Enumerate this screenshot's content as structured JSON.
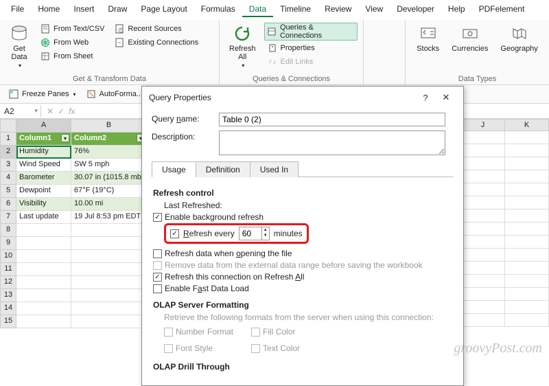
{
  "menu": {
    "items": [
      "File",
      "Home",
      "Insert",
      "Draw",
      "Page Layout",
      "Formulas",
      "Data",
      "Timeline",
      "Review",
      "View",
      "Developer",
      "Help",
      "PDFelement"
    ],
    "active": "Data"
  },
  "ribbon": {
    "get_data": "Get\nData",
    "get_transform_items": [
      "From Text/CSV",
      "Recent Sources",
      "From Web",
      "Existing Connections",
      "From Sheet"
    ],
    "get_transform_label": "Get & Transform Data",
    "refresh_all": "Refresh\nAll",
    "qc_items": [
      "Queries & Connections",
      "Properties",
      "Edit Links"
    ],
    "qc_label": "Queries & Connections",
    "datatypes": [
      "Stocks",
      "Currencies",
      "Geography"
    ],
    "datatypes_label": "Data Types"
  },
  "qat": {
    "freeze": "Freeze Panes",
    "autoformat": "AutoForma..."
  },
  "namebox": "A2",
  "fx": {
    "x": "✕",
    "check": "✓",
    "fx": "fx"
  },
  "grid": {
    "cols": [
      "A",
      "B"
    ],
    "rightcols": [
      "J",
      "K"
    ],
    "header": [
      "Column1",
      "Column2"
    ],
    "rows": [
      {
        "n": 2,
        "a": "Humidity",
        "b": "76%"
      },
      {
        "n": 3,
        "a": "Wind Speed",
        "b": "SW 5 mph"
      },
      {
        "n": 4,
        "a": "Barometer",
        "b": "30.07 in (1015.8 mb)"
      },
      {
        "n": 5,
        "a": "Dewpoint",
        "b": "67°F (19°C)"
      },
      {
        "n": 6,
        "a": "Visibility",
        "b": "10.00 mi"
      },
      {
        "n": 7,
        "a": "Last update",
        "b": "19 Jul 8:53 pm EDT"
      }
    ],
    "empty": [
      8,
      9,
      10,
      11,
      12,
      13,
      14,
      15
    ]
  },
  "dialog": {
    "title": "Query Properties",
    "help": "?",
    "close": "✕",
    "qname_label": "Query name:",
    "qname_value": "Table 0 (2)",
    "desc_label": "Description:",
    "tabs": [
      "Usage",
      "Definition",
      "Used In"
    ],
    "active_tab": "Usage",
    "section_refresh": "Refresh control",
    "last_refreshed": "Last Refreshed:",
    "enable_bg": "Enable background refresh",
    "refresh_every_pre": "Refresh every",
    "refresh_every_val": "60",
    "refresh_every_post": "minutes",
    "refresh_open": "Refresh data when opening the file",
    "remove_data": "Remove data from the external data range before saving the workbook",
    "refresh_all_chk": "Refresh this connection on Refresh All",
    "fast_load": "Enable Fast Data Load",
    "olap_fmt": "OLAP Server Formatting",
    "olap_msg": "Retrieve the following formats from the server when using this connection:",
    "olap_items": [
      "Number Format",
      "Fill Color",
      "Font Style",
      "Text Color"
    ],
    "olap_drill": "OLAP Drill Through"
  },
  "watermark": "groovyPost.com"
}
